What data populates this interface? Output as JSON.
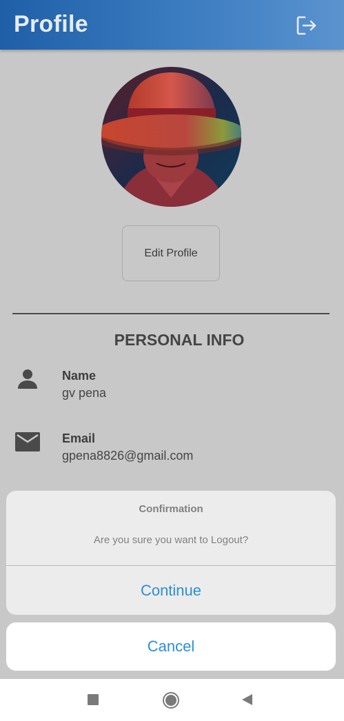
{
  "appbar": {
    "title": "Profile",
    "logout_icon": "logout-icon"
  },
  "profile": {
    "avatar_icon": "avatar-image",
    "edit_button": "Edit Profile",
    "section_title": "PERSONAL INFO",
    "fields": [
      {
        "icon": "person-icon",
        "label": "Name",
        "value": "gv pena"
      },
      {
        "icon": "mail-icon",
        "label": "Email",
        "value": "gpena8826@gmail.com"
      }
    ]
  },
  "dialog": {
    "title": "Confirmation",
    "message": "Are you sure you want to Logout?",
    "continue_label": "Continue",
    "cancel_label": "Cancel"
  },
  "navbar": {
    "recents_icon": "square-icon",
    "home_icon": "circle-icon",
    "back_icon": "triangle-back-icon"
  },
  "colors": {
    "appbar": "#2f6fb7",
    "background": "#c8c8c8",
    "action": "#2a8fd6"
  }
}
